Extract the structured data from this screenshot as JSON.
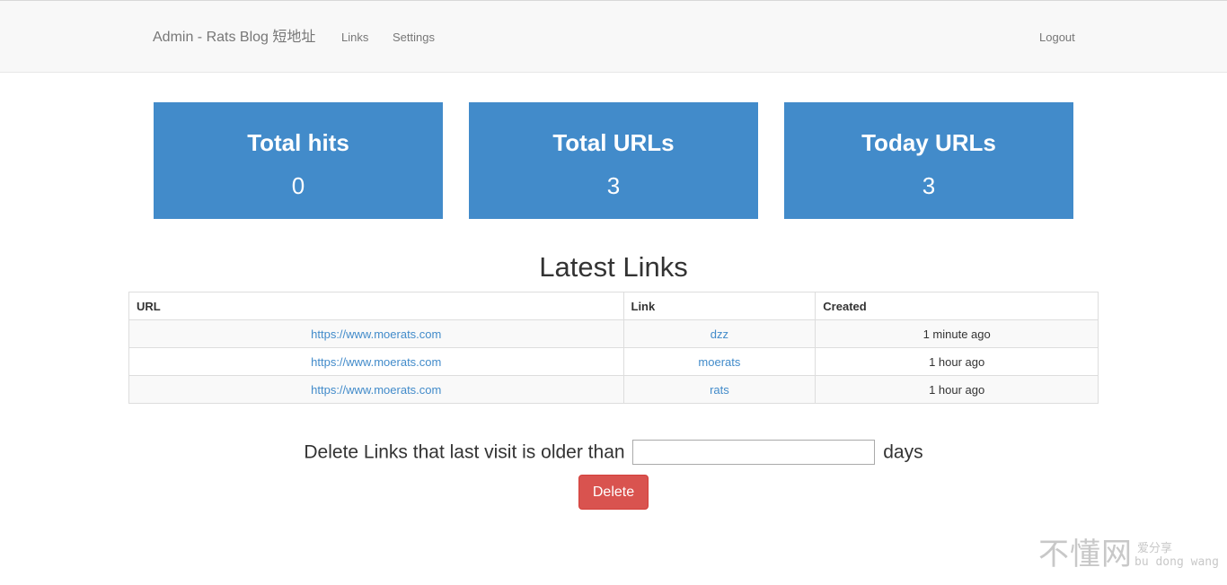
{
  "navbar": {
    "brand": "Admin - Rats Blog 短地址",
    "links_label": "Links",
    "settings_label": "Settings",
    "logout_label": "Logout"
  },
  "stats": [
    {
      "title": "Total hits",
      "value": "0"
    },
    {
      "title": "Total URLs",
      "value": "3"
    },
    {
      "title": "Today URLs",
      "value": "3"
    }
  ],
  "latest_links": {
    "title": "Latest Links",
    "columns": [
      "URL",
      "Link",
      "Created"
    ],
    "rows": [
      {
        "url": "https://www.moerats.com",
        "link": "dzz",
        "created": "1 minute ago"
      },
      {
        "url": "https://www.moerats.com",
        "link": "moerats",
        "created": "1 hour ago"
      },
      {
        "url": "https://www.moerats.com",
        "link": "rats",
        "created": "1 hour ago"
      }
    ]
  },
  "delete_form": {
    "prefix": "Delete Links that last visit is older than",
    "input_value": "",
    "suffix": "days",
    "button_label": "Delete"
  },
  "watermark": {
    "main": "不懂网",
    "sub_top": "爱分享",
    "sub_bottom": "bu dong wang"
  },
  "colors": {
    "card_blue": "#428bca",
    "danger_red": "#d9534f",
    "navbar_bg": "#f8f8f8",
    "link_blue": "#428bca"
  }
}
